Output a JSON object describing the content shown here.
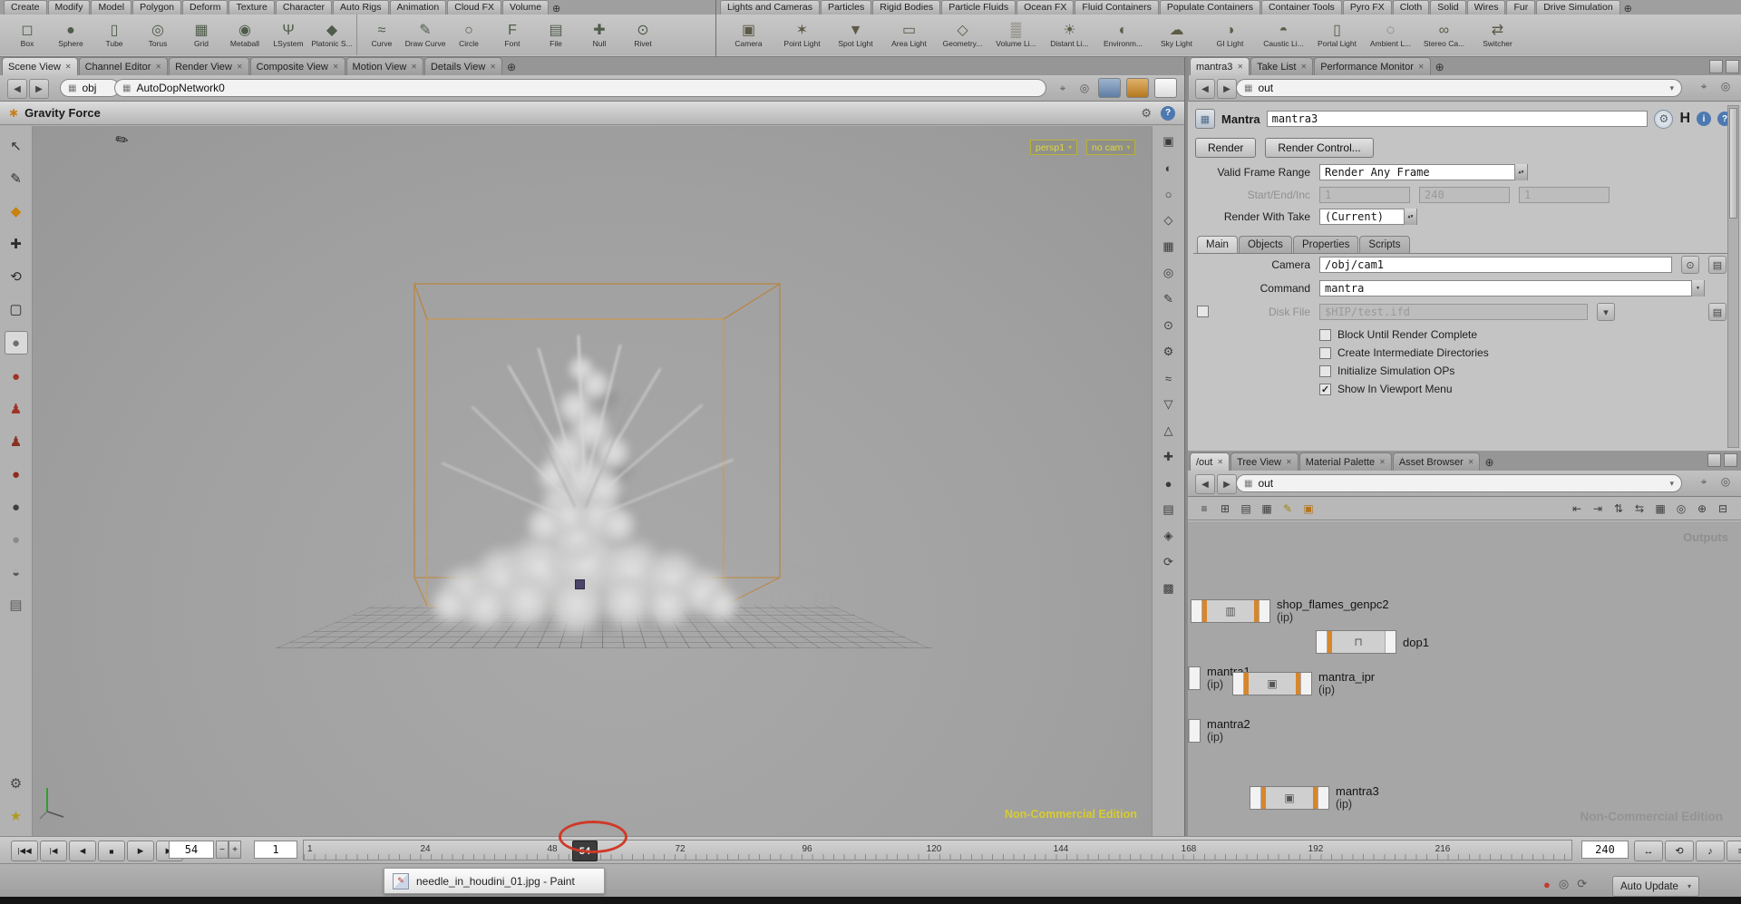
{
  "icons": {
    "back": "◀",
    "fwd": "▶",
    "plus": "⊕",
    "close": "✕",
    "pin": "⌖",
    "target": "◎",
    "dropdown": "▾",
    "help": "?",
    "info": "i",
    "gear": "⚙",
    "hlogo": "H",
    "cube": "▦",
    "paint": "✎",
    "minus": "−",
    "plus_small": "+",
    "chooser": "⊙",
    "tree": "▤",
    "file": "▤",
    "header_icon": "✱"
  },
  "shelf": {
    "left_tabs": [
      "Create",
      "Modify",
      "Model",
      "Polygon",
      "Deform",
      "Texture",
      "Character",
      "Auto Rigs",
      "Animation",
      "Cloud FX",
      "Volume"
    ],
    "right_tabs": [
      "Lights and Cameras",
      "Particles",
      "Rigid Bodies",
      "Particle Fluids",
      "Ocean FX",
      "Fluid Containers",
      "Populate Containers",
      "Container Tools",
      "Pyro FX",
      "Cloth",
      "Solid",
      "Wires",
      "Fur",
      "Drive Simulation"
    ],
    "left_tools": [
      {
        "label": "Box",
        "glyph": "◻"
      },
      {
        "label": "Sphere",
        "glyph": "●"
      },
      {
        "label": "Tube",
        "glyph": "▯"
      },
      {
        "label": "Torus",
        "glyph": "◎"
      },
      {
        "label": "Grid",
        "glyph": "▦"
      },
      {
        "label": "Metaball",
        "glyph": "◉"
      },
      {
        "label": "LSystem",
        "glyph": "Ψ"
      },
      {
        "label": "Platonic S...",
        "glyph": "◆"
      },
      {
        "label": "Curve",
        "glyph": "≈"
      },
      {
        "label": "Draw Curve",
        "glyph": "✎"
      },
      {
        "label": "Circle",
        "glyph": "○"
      },
      {
        "label": "Font",
        "glyph": "F"
      },
      {
        "label": "File",
        "glyph": "▤"
      },
      {
        "label": "Null",
        "glyph": "✚"
      },
      {
        "label": "Rivet",
        "glyph": "⊙"
      }
    ],
    "right_tools": [
      {
        "label": "Camera",
        "glyph": "▣"
      },
      {
        "label": "Point Light",
        "glyph": "✶"
      },
      {
        "label": "Spot Light",
        "glyph": "▼"
      },
      {
        "label": "Area Light",
        "glyph": "▭"
      },
      {
        "label": "Geometry...",
        "glyph": "◇"
      },
      {
        "label": "Volume Li...",
        "glyph": "▒"
      },
      {
        "label": "Distant Li...",
        "glyph": "☀"
      },
      {
        "label": "Environm...",
        "glyph": "◐"
      },
      {
        "label": "Sky Light",
        "glyph": "☁"
      },
      {
        "label": "GI Light",
        "glyph": "◑"
      },
      {
        "label": "Caustic Li...",
        "glyph": "◓"
      },
      {
        "label": "Portal Light",
        "glyph": "▯"
      },
      {
        "label": "Ambient L...",
        "glyph": "◌"
      },
      {
        "label": "Stereo Ca...",
        "glyph": "∞"
      },
      {
        "label": "Switcher",
        "glyph": "⇄"
      }
    ]
  },
  "panes": {
    "left_tabs": [
      "Scene View",
      "Channel Editor",
      "Render View",
      "Composite View",
      "Motion View",
      "Details View"
    ],
    "right_tabs": [
      "mantra3",
      "Take List",
      "Performance Monitor"
    ],
    "net_tabs": [
      "/out",
      "Tree View",
      "Material Palette",
      "Asset Browser"
    ]
  },
  "pathbar": {
    "context": "obj",
    "path": "AutoDopNetwork0",
    "out_path": "out",
    "net_path": "out"
  },
  "viewport": {
    "title": "Gravity Force",
    "cam_menu": "persp1",
    "cam_link": "no cam",
    "watermark": "Non-Commercial Edition",
    "left_toolbar": [
      {
        "name": "select-arrow-icon",
        "g": "↖",
        "c": "#2e2e2e"
      },
      {
        "name": "paint-brush-icon",
        "g": "✎",
        "c": "#2e2e2e"
      },
      {
        "name": "paint-bucket-icon",
        "g": "◆",
        "c": "#c9820e"
      },
      {
        "name": "translate-icon",
        "g": "✚",
        "c": "#2e2e2e"
      },
      {
        "name": "rotate-icon",
        "g": "⟲",
        "c": "#2e2e2e"
      },
      {
        "name": "scale-icon",
        "g": "▢",
        "c": "#2e2e2e"
      },
      {
        "name": "gravity-tool-icon",
        "g": "●",
        "c": "#6e6e6e",
        "active": true
      },
      {
        "name": "rbd-object-icon",
        "g": "●",
        "c": "#a03326"
      },
      {
        "name": "ragdoll-icon",
        "g": "♟",
        "c": "#a03326"
      },
      {
        "name": "character-icon",
        "g": "♟",
        "c": "#8a2f22"
      },
      {
        "name": "sticky-ball-icon",
        "g": "●",
        "c": "#8f2a1e"
      },
      {
        "name": "dark-sphere-icon",
        "g": "●",
        "c": "#3f3f3f"
      },
      {
        "name": "clay-ball-icon",
        "g": "●",
        "c": "#8a8a8a"
      },
      {
        "name": "dome-icon",
        "g": "◒",
        "c": "#5a5a5a"
      },
      {
        "name": "cloth-grid-icon",
        "g": "▤",
        "c": "#5a5a5a"
      },
      {
        "name": "tools-icon",
        "g": "⚙",
        "c": "#444444"
      },
      {
        "name": "star-icon",
        "g": "★",
        "c": "#b09a20"
      }
    ],
    "right_toolbar": [
      {
        "name": "view-mode-icon",
        "g": "▣"
      },
      {
        "name": "shade-icon",
        "g": "◐"
      },
      {
        "name": "wireframe-icon",
        "g": "○"
      },
      {
        "name": "normals-icon",
        "g": "◇"
      },
      {
        "name": "grid-icon",
        "g": "▦"
      },
      {
        "name": "lens-icon",
        "g": "◎"
      },
      {
        "name": "annotate-icon",
        "g": "✎"
      },
      {
        "name": "point-icon",
        "g": "⊙"
      },
      {
        "name": "options-gear-icon",
        "g": "⚙"
      },
      {
        "name": "fog-icon",
        "g": "≈"
      },
      {
        "name": "cone-icon",
        "g": "▽"
      },
      {
        "name": "pyramid-icon",
        "g": "△"
      },
      {
        "name": "add-icon",
        "g": "✚"
      },
      {
        "name": "dot-icon",
        "g": "●"
      },
      {
        "name": "layers-icon",
        "g": "▤"
      },
      {
        "name": "gem-icon",
        "g": "◈"
      },
      {
        "name": "refresh-icon",
        "g": "⟳"
      },
      {
        "name": "mask-icon",
        "g": "▩"
      }
    ]
  },
  "mantra": {
    "type_label": "Mantra",
    "name": "mantra3",
    "render_btn": "Render",
    "render_control_btn": "Render Control...",
    "valid_frame_range_label": "Valid Frame Range",
    "valid_frame_range": "Render Any Frame",
    "start_end_inc_label": "Start/End/Inc",
    "start": "1",
    "end": "240",
    "inc": "1",
    "render_with_take_label": "Render With Take",
    "render_with_take": "(Current)",
    "tabs": [
      "Main",
      "Objects",
      "Properties",
      "Scripts"
    ],
    "camera_label": "Camera",
    "camera": "/obj/cam1",
    "command_label": "Command",
    "command": "mantra",
    "disk_file_label": "Disk File",
    "disk_file": "$HIP/test.ifd",
    "checkboxes": [
      {
        "label": "Block Until Render Complete",
        "checked": false
      },
      {
        "label": "Create Intermediate Directories",
        "checked": false
      },
      {
        "label": "Initialize Simulation OPs",
        "checked": false
      },
      {
        "label": "Show In Viewport Menu",
        "checked": true
      }
    ]
  },
  "network": {
    "outputs_label": "Outputs",
    "watermark": "Non-Commercial Edition",
    "toolbar_left": [
      {
        "name": "badge-list-icon",
        "g": "≡"
      },
      {
        "name": "node-shape-icon",
        "g": "⊞"
      },
      {
        "name": "list-view-icon",
        "g": "▤"
      },
      {
        "name": "grid-view-icon",
        "g": "▦"
      },
      {
        "name": "note-pencil-icon",
        "g": "✎",
        "c": "#9a8a10"
      },
      {
        "name": "network-box-icon",
        "g": "▣",
        "c": "#b5761e"
      }
    ],
    "toolbar_right": [
      {
        "name": "align-left-icon",
        "g": "⇤"
      },
      {
        "name": "align-right-icon",
        "g": "⇥"
      },
      {
        "name": "distribute-v-icon",
        "g": "⇅"
      },
      {
        "name": "distribute-h-icon",
        "g": "⇆"
      },
      {
        "name": "snap-grid-icon",
        "g": "▦"
      },
      {
        "name": "zoom-sel-icon",
        "g": "◎"
      },
      {
        "name": "zoom-fit-icon",
        "g": "⊕"
      },
      {
        "name": "export-icon",
        "g": "⊟"
      }
    ],
    "nodes": [
      {
        "name": "shop_flames_genpc2",
        "sub": "(ip)",
        "glyph": "▥"
      },
      {
        "name": "dop1",
        "sub": "",
        "glyph": "⊓"
      },
      {
        "name": "mantra1",
        "sub": "(ip)",
        "glyph": ""
      },
      {
        "name": "mantra_ipr",
        "sub": "(ip)",
        "glyph": "▣"
      },
      {
        "name": "mantra2",
        "sub": "(ip)",
        "glyph": ""
      },
      {
        "name": "mantra3",
        "sub": "(ip)",
        "glyph": "▣"
      }
    ]
  },
  "playbar": {
    "transport": [
      {
        "name": "jump-start-button",
        "g": "|◀◀"
      },
      {
        "name": "prev-key-button",
        "g": "|◀"
      },
      {
        "name": "step-back-button",
        "g": "◀"
      },
      {
        "name": "stop-button",
        "g": "■"
      },
      {
        "name": "play-button",
        "g": "▶"
      },
      {
        "name": "step-forward-button",
        "g": "▶|"
      }
    ],
    "current_frame": "54",
    "start_frame": "1",
    "end_frame": "240",
    "ticks": [
      "1",
      "24",
      "48",
      "72",
      "96",
      "120",
      "144",
      "168",
      "192",
      "216"
    ],
    "right_buttons": [
      {
        "name": "range-button",
        "g": "↔"
      },
      {
        "name": "loop-button",
        "g": "⟲"
      },
      {
        "name": "audio-button",
        "g": "♪"
      },
      {
        "name": "playbar-options-button",
        "g": "≡"
      }
    ]
  },
  "statusbar": {
    "paint_item": "needle_in_houdini_01.jpg - Paint",
    "auto_update": "Auto Update",
    "icons": [
      {
        "name": "error-badge-icon",
        "g": "●",
        "c": "#c23b2e"
      },
      {
        "name": "magnify-icon",
        "g": "◎",
        "c": "#555555"
      },
      {
        "name": "resync-icon",
        "g": "⟳",
        "c": "#555555"
      }
    ]
  }
}
